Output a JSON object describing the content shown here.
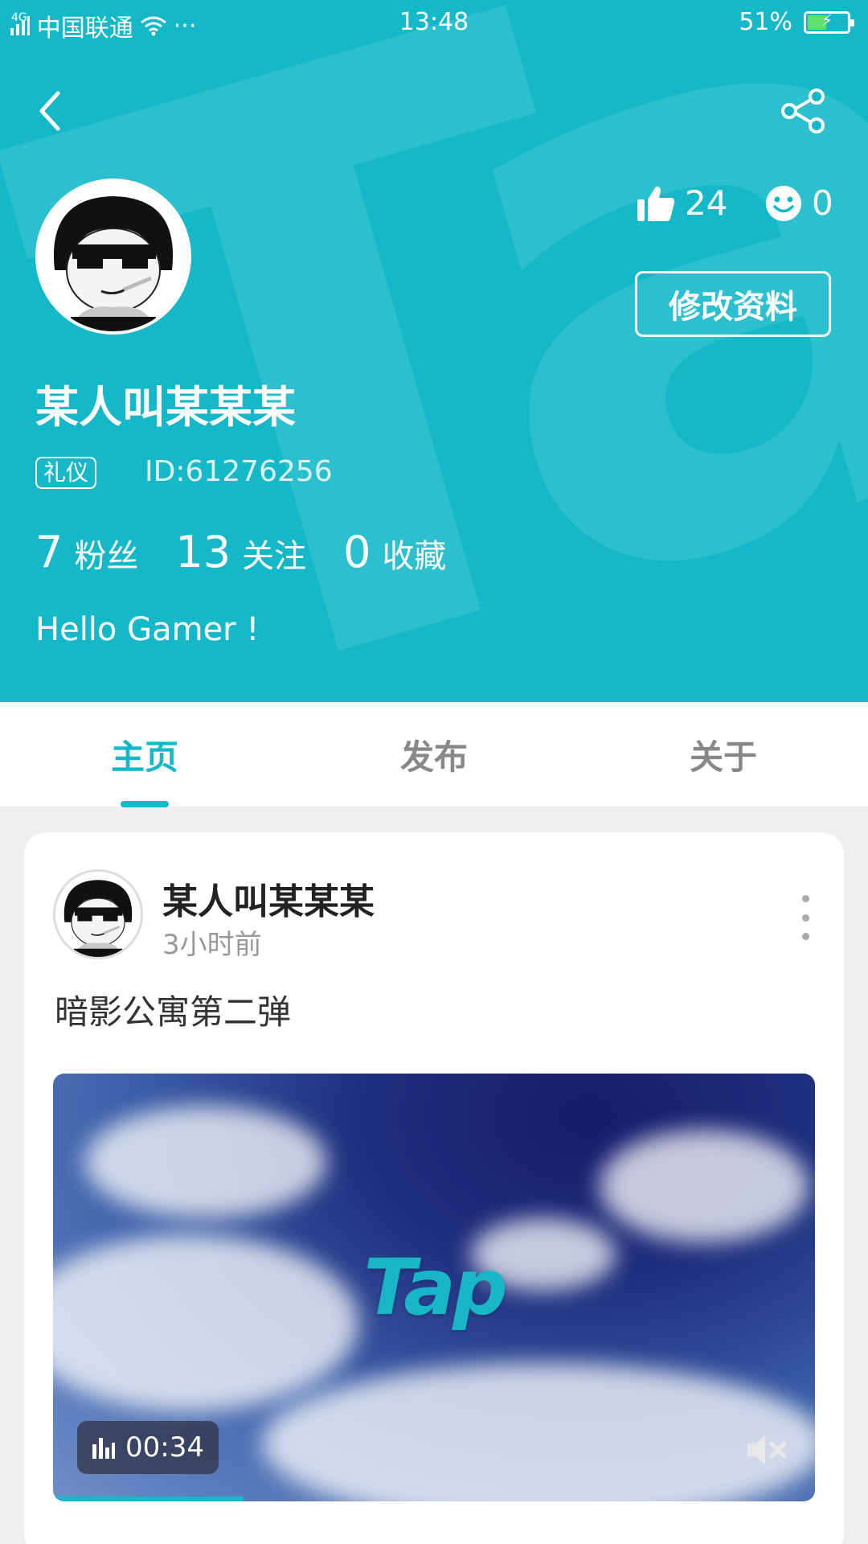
{
  "status_bar": {
    "network": "4G",
    "carrier": "中国联通",
    "more": "···",
    "time": "13:48",
    "battery_percent": "51%",
    "battery_level": 0.51
  },
  "header": {
    "bg_watermark": "TapTap",
    "likes": "24",
    "smiles": "0",
    "edit_profile_label": "修改资料",
    "username": "某人叫某某某",
    "badge": "礼仪",
    "user_id": "ID:61276256",
    "stats": [
      {
        "value": "7",
        "label": "粉丝"
      },
      {
        "value": "13",
        "label": "关注"
      },
      {
        "value": "0",
        "label": "收藏"
      }
    ],
    "bio": "Hello Gamer !"
  },
  "tabs": [
    {
      "label": "主页",
      "active": true
    },
    {
      "label": "发布",
      "active": false
    },
    {
      "label": "关于",
      "active": false
    }
  ],
  "post": {
    "author": "某人叫某某某",
    "time": "3小时前",
    "text": "暗影公寓第二弹",
    "video": {
      "logo": "Tap",
      "duration": "00:34",
      "progress": 0.25
    }
  },
  "colors": {
    "accent": "#15b8c9",
    "background": "#efefef"
  },
  "icons": {
    "back": "back-arrow-icon",
    "share": "share-icon",
    "like": "thumbs-up-icon",
    "smile": "smile-icon",
    "more": "more-vertical-icon",
    "audio_bars": "audio-bars-icon",
    "mute": "mute-icon",
    "signal": "signal-icon",
    "wifi": "wifi-icon",
    "battery": "battery-icon"
  }
}
